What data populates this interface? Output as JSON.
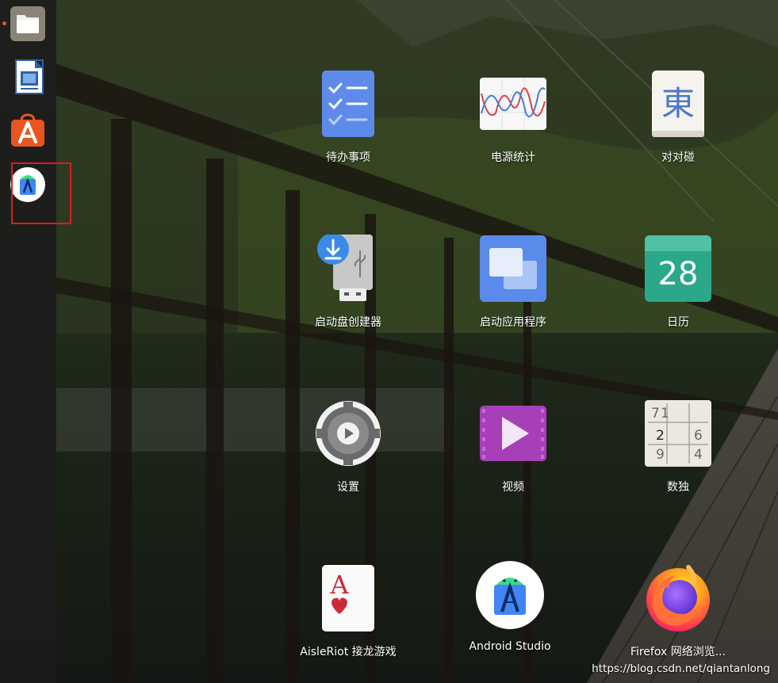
{
  "dock": {
    "items": [
      {
        "name": "files",
        "icon": "folder-icon",
        "running": true
      },
      {
        "name": "libreoffice-writer",
        "icon": "writer-document-icon",
        "running": false
      },
      {
        "name": "ubuntu-software",
        "icon": "software-store-icon",
        "running": false
      },
      {
        "name": "android-studio",
        "icon": "android-studio-icon",
        "running": false,
        "highlighted": true
      }
    ]
  },
  "apps": [
    {
      "label": "待办事项",
      "icon": "todo-checklist-icon"
    },
    {
      "label": "电源统计",
      "icon": "power-statistics-icon"
    },
    {
      "label": "对对碰",
      "icon": "mahjongg-tile-icon"
    },
    {
      "label": "启动盘创建器",
      "icon": "usb-creator-icon"
    },
    {
      "label": "启动应用程序",
      "icon": "startup-apps-icon"
    },
    {
      "label": "日历",
      "icon": "calendar-icon"
    },
    {
      "label": "设置",
      "icon": "settings-gear-icon"
    },
    {
      "label": "视频",
      "icon": "video-play-icon"
    },
    {
      "label": "数独",
      "icon": "sudoku-grid-icon"
    },
    {
      "label": "AisleRiot 接龙游戏",
      "icon": "playing-card-icon"
    },
    {
      "label": "Android Studio",
      "icon": "android-studio-icon"
    },
    {
      "label": "Firefox 网络浏览...",
      "icon": "firefox-icon"
    }
  ],
  "calendar_day": "28",
  "mahjongg_char": "東",
  "sudoku_cells": [
    "7",
    "1",
    "",
    "",
    "",
    "",
    "2",
    "",
    "6",
    "9",
    "",
    "4"
  ],
  "card_rank": "A",
  "watermark": "https://blog.csdn.net/qiantanlong",
  "colors": {
    "dock_bg": "#1c1c1c",
    "highlight_border": "#d81e1e",
    "running_indicator": "#e95420",
    "label_text": "#ffffff"
  }
}
